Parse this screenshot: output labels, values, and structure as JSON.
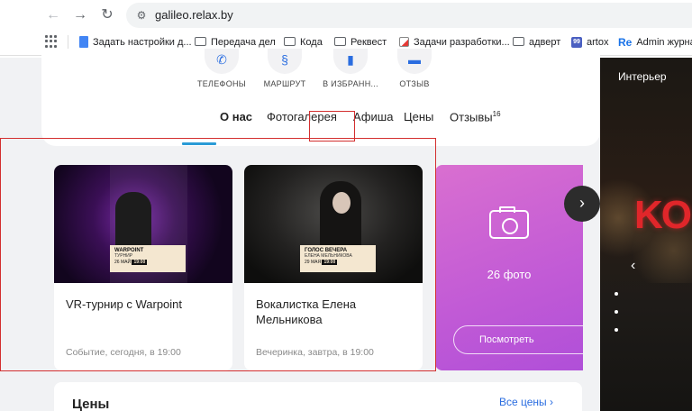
{
  "browser": {
    "url": "galileo.relax.by",
    "bookmarks": [
      {
        "label": "Задать настройки д...",
        "icon": "google-docs-icon"
      },
      {
        "label": "Передача дел",
        "icon": "folder-icon"
      },
      {
        "label": "Кода",
        "icon": "folder-icon"
      },
      {
        "label": "Реквест",
        "icon": "folder-icon"
      },
      {
        "label": "Задачи разработки...",
        "icon": "task-icon"
      },
      {
        "label": "адверт",
        "icon": "folder-icon"
      },
      {
        "label": "artox",
        "icon": "artox-icon"
      },
      {
        "label": "Admin журнал",
        "icon": "re-icon"
      }
    ]
  },
  "actions": [
    {
      "label": "ТЕЛЕФОНЫ",
      "icon": "phone-icon"
    },
    {
      "label": "МАРШРУТ",
      "icon": "route-icon"
    },
    {
      "label": "В ИЗБРАНН...",
      "icon": "bookmark-icon"
    },
    {
      "label": "ОТЗЫВ",
      "icon": "comment-icon"
    }
  ],
  "tabs": [
    {
      "label": "О нас",
      "active": true
    },
    {
      "label": "Фотогалерея",
      "active": false
    },
    {
      "label": "Афиша",
      "active": false
    },
    {
      "label": "Цены",
      "active": false
    },
    {
      "label": "Отзывы",
      "active": false,
      "count": "16"
    }
  ],
  "events": [
    {
      "title": "VR-турнир с Warpoint",
      "meta": "Событие, сегодня, в 19:00",
      "poster": {
        "t1": "WARPOINT",
        "t2": "ТУРНИР",
        "date": "26 МАЙ",
        "time": "19:00"
      }
    },
    {
      "title": "Вокалистка Елена Мельникова",
      "meta": "Вечеринка, завтра, в 19:00",
      "poster": {
        "t1": "ГОЛОС ВЕЧЕРА",
        "t2": "ЕЛЕНА МЕЛЬНИКОВА",
        "date": "29 МАЯ",
        "time": "19:00"
      }
    }
  ],
  "photo_card": {
    "count": "26 фото",
    "button": "Посмотреть"
  },
  "right_photo": {
    "label": "Интерьер"
  },
  "prices": {
    "title": "Цены",
    "all_link": "Все цены"
  },
  "colors": {
    "accent": "#2a6de0",
    "highlight": "#d32f2f",
    "tab_underline": "#2a9bd6",
    "photo_gradient": "#c15ad6"
  }
}
